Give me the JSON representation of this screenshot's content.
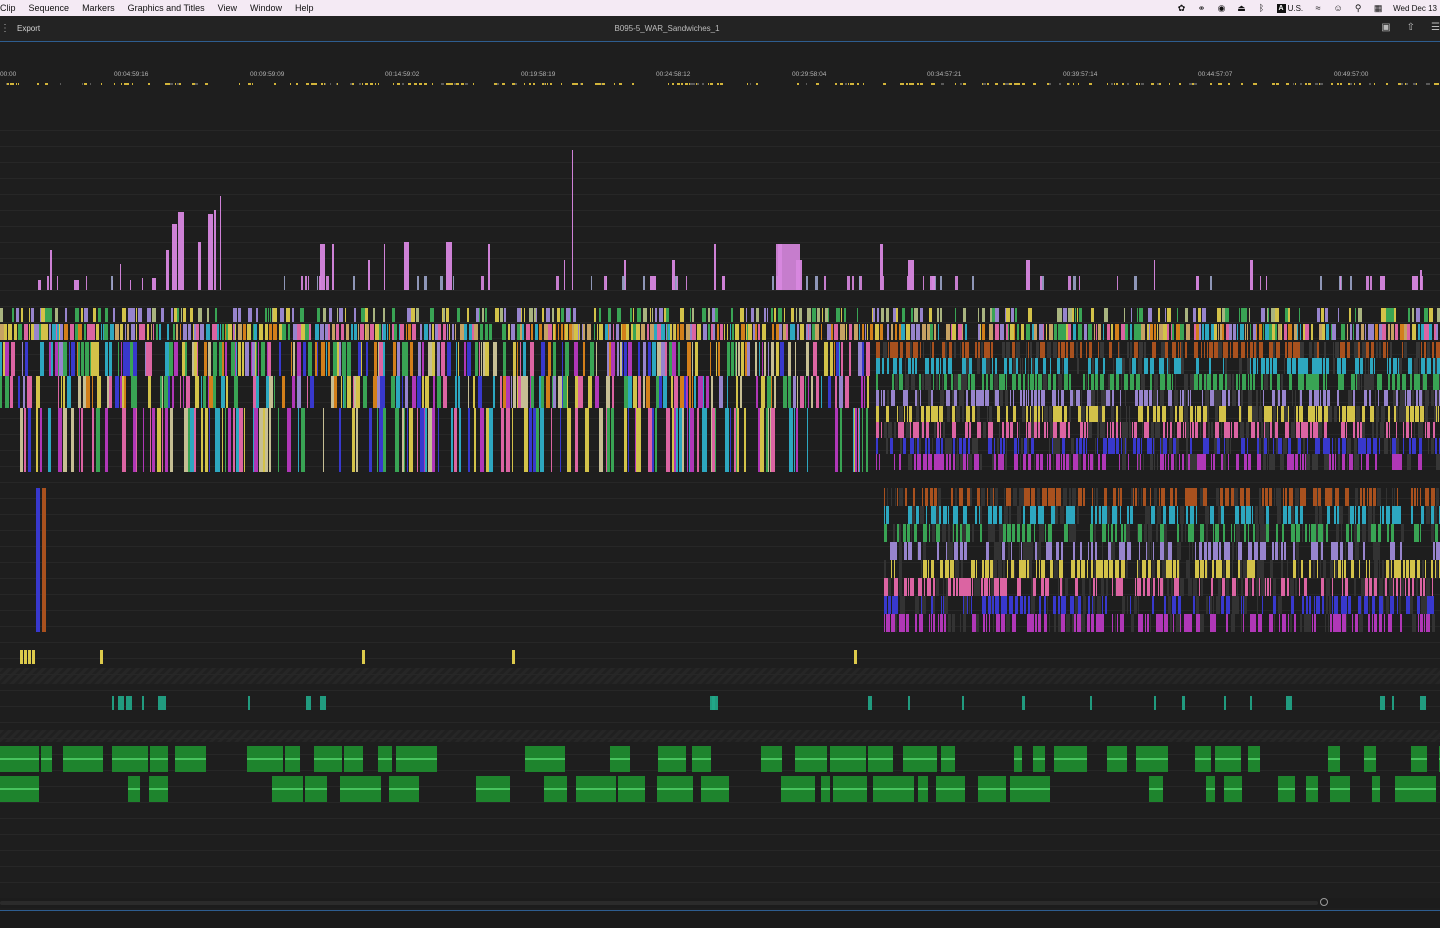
{
  "menubar": {
    "items": [
      "Clip",
      "Sequence",
      "Markers",
      "Graphics and Titles",
      "View",
      "Window",
      "Help"
    ],
    "input_badge": "A",
    "input_source": "U.S.",
    "date": "Wed Dec 13"
  },
  "header": {
    "export_label": "Export",
    "sequence_title": "B095-5_WAR_Sandwiches_1"
  },
  "ruler": {
    "timecodes": [
      "00:00",
      "00:04:59:16",
      "00:09:59:09",
      "00:14:59:02",
      "00:19:58:19",
      "00:24:58:12",
      "00:29:58:04",
      "00:34:57:21",
      "00:39:57:14",
      "00:44:57:07",
      "00:49:57:00"
    ]
  },
  "colors": {
    "orange": "#e58a1a",
    "rust": "#b8571e",
    "cyan": "#2fb6d1",
    "green": "#3cb35a",
    "lavender": "#a48fe0",
    "yellow": "#e7d44e",
    "pink": "#f06bb0",
    "blue": "#3b3be0",
    "magenta": "#c03ac8",
    "violet": "#d887e0",
    "audio": "#1f8a2e",
    "teal": "#21a88a"
  }
}
